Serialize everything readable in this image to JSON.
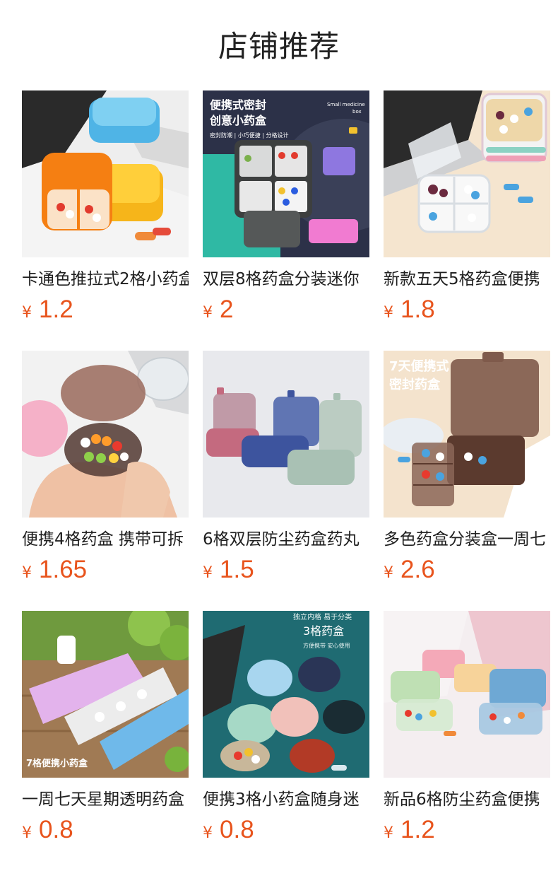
{
  "section": {
    "title": "店铺推荐"
  },
  "currency_symbol": "¥",
  "accent_color": "#e8541d",
  "products": [
    {
      "name": "卡通色推拉式2格小药盒",
      "price": "1.2",
      "image_text": []
    },
    {
      "name": "双层8格药盒分装迷你",
      "price": "2",
      "image_text": [
        "便携式密封",
        "创意小药盒",
        "密封防潮 | 小巧便捷 | 分格设计",
        "Small medicine",
        "box"
      ]
    },
    {
      "name": "新款五天5格药盒便携",
      "price": "1.8",
      "image_text": []
    },
    {
      "name": "便携4格药盒 携带可拆",
      "price": "1.65",
      "image_text": []
    },
    {
      "name": "6格双层防尘药盒药丸",
      "price": "1.5",
      "image_text": []
    },
    {
      "name": "多色药盒分装盒一周七",
      "price": "2.6",
      "image_text": [
        "7天便携式",
        "密封药盒"
      ]
    },
    {
      "name": "一周七天星期透明药盒",
      "price": "0.8",
      "image_text": [
        "7格便携小药盒"
      ]
    },
    {
      "name": "便携3格小药盒随身迷",
      "price": "0.8",
      "image_text": [
        "独立内格 易于分类",
        "3格药盒",
        "方便携带 安心使用"
      ]
    },
    {
      "name": "新品6格防尘药盒便携",
      "price": "1.2",
      "image_text": []
    }
  ]
}
